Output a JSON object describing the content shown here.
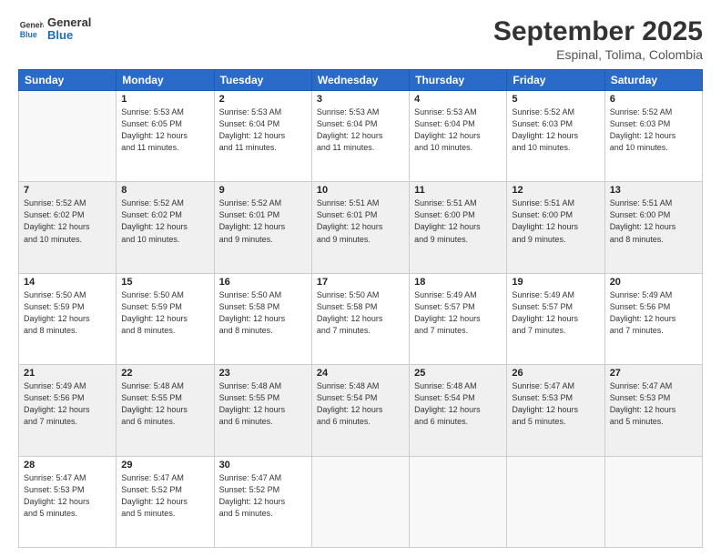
{
  "header": {
    "logo_general": "General",
    "logo_blue": "Blue",
    "month": "September 2025",
    "location": "Espinal, Tolima, Colombia"
  },
  "days_of_week": [
    "Sunday",
    "Monday",
    "Tuesday",
    "Wednesday",
    "Thursday",
    "Friday",
    "Saturday"
  ],
  "weeks": [
    {
      "shaded": false,
      "days": [
        {
          "num": "",
          "info": ""
        },
        {
          "num": "1",
          "info": "Sunrise: 5:53 AM\nSunset: 6:05 PM\nDaylight: 12 hours\nand 11 minutes."
        },
        {
          "num": "2",
          "info": "Sunrise: 5:53 AM\nSunset: 6:04 PM\nDaylight: 12 hours\nand 11 minutes."
        },
        {
          "num": "3",
          "info": "Sunrise: 5:53 AM\nSunset: 6:04 PM\nDaylight: 12 hours\nand 11 minutes."
        },
        {
          "num": "4",
          "info": "Sunrise: 5:53 AM\nSunset: 6:04 PM\nDaylight: 12 hours\nand 10 minutes."
        },
        {
          "num": "5",
          "info": "Sunrise: 5:52 AM\nSunset: 6:03 PM\nDaylight: 12 hours\nand 10 minutes."
        },
        {
          "num": "6",
          "info": "Sunrise: 5:52 AM\nSunset: 6:03 PM\nDaylight: 12 hours\nand 10 minutes."
        }
      ]
    },
    {
      "shaded": true,
      "days": [
        {
          "num": "7",
          "info": "Sunrise: 5:52 AM\nSunset: 6:02 PM\nDaylight: 12 hours\nand 10 minutes."
        },
        {
          "num": "8",
          "info": "Sunrise: 5:52 AM\nSunset: 6:02 PM\nDaylight: 12 hours\nand 10 minutes."
        },
        {
          "num": "9",
          "info": "Sunrise: 5:52 AM\nSunset: 6:01 PM\nDaylight: 12 hours\nand 9 minutes."
        },
        {
          "num": "10",
          "info": "Sunrise: 5:51 AM\nSunset: 6:01 PM\nDaylight: 12 hours\nand 9 minutes."
        },
        {
          "num": "11",
          "info": "Sunrise: 5:51 AM\nSunset: 6:00 PM\nDaylight: 12 hours\nand 9 minutes."
        },
        {
          "num": "12",
          "info": "Sunrise: 5:51 AM\nSunset: 6:00 PM\nDaylight: 12 hours\nand 9 minutes."
        },
        {
          "num": "13",
          "info": "Sunrise: 5:51 AM\nSunset: 6:00 PM\nDaylight: 12 hours\nand 8 minutes."
        }
      ]
    },
    {
      "shaded": false,
      "days": [
        {
          "num": "14",
          "info": "Sunrise: 5:50 AM\nSunset: 5:59 PM\nDaylight: 12 hours\nand 8 minutes."
        },
        {
          "num": "15",
          "info": "Sunrise: 5:50 AM\nSunset: 5:59 PM\nDaylight: 12 hours\nand 8 minutes."
        },
        {
          "num": "16",
          "info": "Sunrise: 5:50 AM\nSunset: 5:58 PM\nDaylight: 12 hours\nand 8 minutes."
        },
        {
          "num": "17",
          "info": "Sunrise: 5:50 AM\nSunset: 5:58 PM\nDaylight: 12 hours\nand 7 minutes."
        },
        {
          "num": "18",
          "info": "Sunrise: 5:49 AM\nSunset: 5:57 PM\nDaylight: 12 hours\nand 7 minutes."
        },
        {
          "num": "19",
          "info": "Sunrise: 5:49 AM\nSunset: 5:57 PM\nDaylight: 12 hours\nand 7 minutes."
        },
        {
          "num": "20",
          "info": "Sunrise: 5:49 AM\nSunset: 5:56 PM\nDaylight: 12 hours\nand 7 minutes."
        }
      ]
    },
    {
      "shaded": true,
      "days": [
        {
          "num": "21",
          "info": "Sunrise: 5:49 AM\nSunset: 5:56 PM\nDaylight: 12 hours\nand 7 minutes."
        },
        {
          "num": "22",
          "info": "Sunrise: 5:48 AM\nSunset: 5:55 PM\nDaylight: 12 hours\nand 6 minutes."
        },
        {
          "num": "23",
          "info": "Sunrise: 5:48 AM\nSunset: 5:55 PM\nDaylight: 12 hours\nand 6 minutes."
        },
        {
          "num": "24",
          "info": "Sunrise: 5:48 AM\nSunset: 5:54 PM\nDaylight: 12 hours\nand 6 minutes."
        },
        {
          "num": "25",
          "info": "Sunrise: 5:48 AM\nSunset: 5:54 PM\nDaylight: 12 hours\nand 6 minutes."
        },
        {
          "num": "26",
          "info": "Sunrise: 5:47 AM\nSunset: 5:53 PM\nDaylight: 12 hours\nand 5 minutes."
        },
        {
          "num": "27",
          "info": "Sunrise: 5:47 AM\nSunset: 5:53 PM\nDaylight: 12 hours\nand 5 minutes."
        }
      ]
    },
    {
      "shaded": false,
      "days": [
        {
          "num": "28",
          "info": "Sunrise: 5:47 AM\nSunset: 5:53 PM\nDaylight: 12 hours\nand 5 minutes."
        },
        {
          "num": "29",
          "info": "Sunrise: 5:47 AM\nSunset: 5:52 PM\nDaylight: 12 hours\nand 5 minutes."
        },
        {
          "num": "30",
          "info": "Sunrise: 5:47 AM\nSunset: 5:52 PM\nDaylight: 12 hours\nand 5 minutes."
        },
        {
          "num": "",
          "info": ""
        },
        {
          "num": "",
          "info": ""
        },
        {
          "num": "",
          "info": ""
        },
        {
          "num": "",
          "info": ""
        }
      ]
    }
  ]
}
